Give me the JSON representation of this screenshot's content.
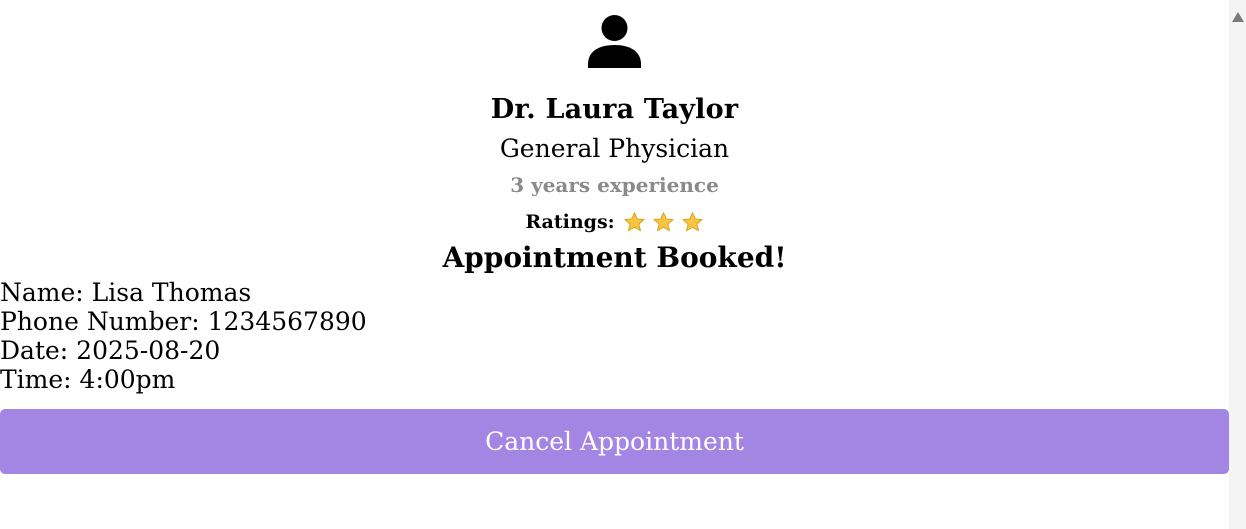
{
  "doctor": {
    "name": "Dr. Laura Taylor",
    "specialty": "General Physician",
    "experience": "3 years experience",
    "ratings_label": "Ratings:",
    "rating": 3
  },
  "appointment": {
    "heading": "Appointment Booked!",
    "name": "Name: Lisa Thomas",
    "phone": "Phone Number: 1234567890",
    "date": "Date: 2025-08-20",
    "time": "Time: 4:00pm",
    "cancel_label": "Cancel Appointment"
  },
  "colors": {
    "button_bg": "#a385e3",
    "experience_text": "#8a8a8a",
    "star_fill": "#f5c542"
  },
  "icons": {
    "avatar": "user-icon",
    "star": "star-icon",
    "scroll_up": "scroll-up-arrow-icon"
  }
}
